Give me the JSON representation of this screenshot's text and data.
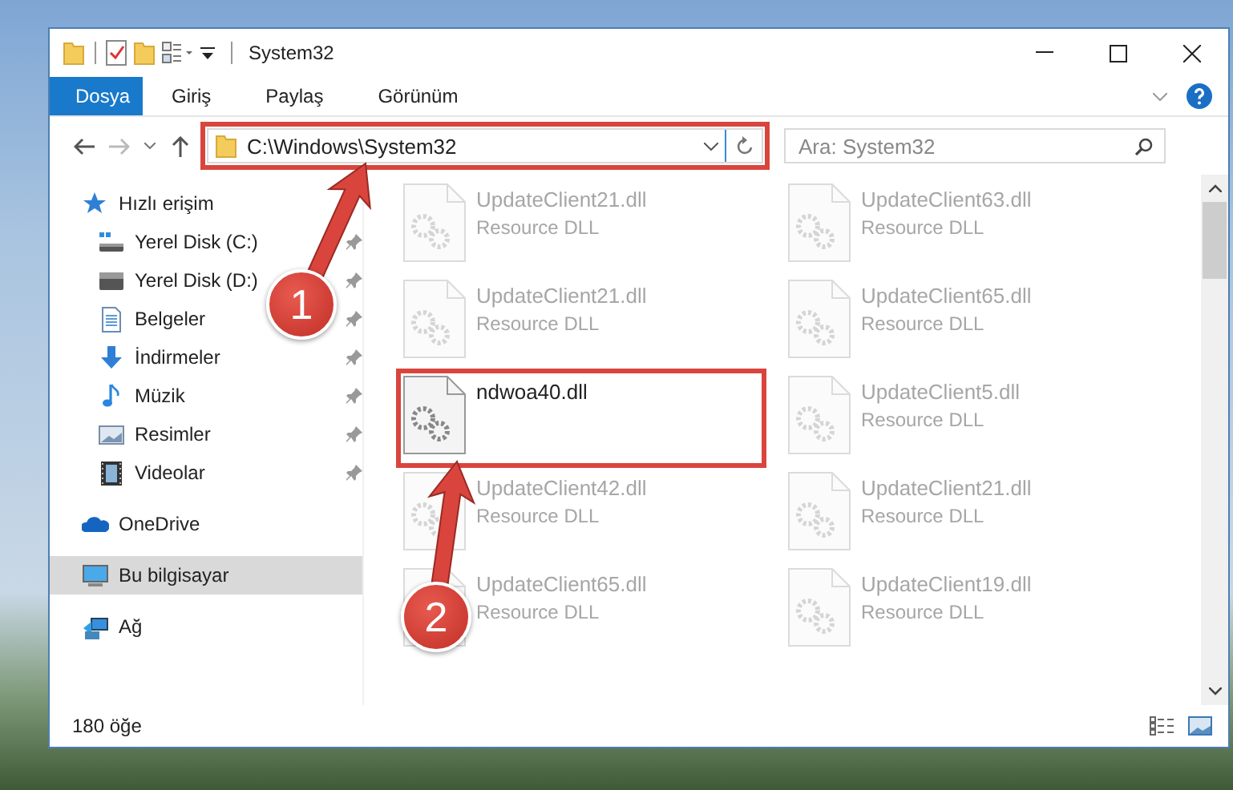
{
  "window": {
    "title": "System32"
  },
  "ribbon_tabs": [
    {
      "label": "Dosya",
      "selected": true
    },
    {
      "label": "Giriş",
      "selected": false
    },
    {
      "label": "Paylaş",
      "selected": false
    },
    {
      "label": "Görünüm",
      "selected": false
    }
  ],
  "address_bar": {
    "path": "C:\\Windows\\System32",
    "highlighted": true
  },
  "search": {
    "placeholder": "Ara: System32"
  },
  "navigation": [
    {
      "label": "Hızlı erişim",
      "kind": "star",
      "selected": false,
      "children": [
        {
          "label": "Yerel Disk (C:)",
          "kind": "system-drive",
          "pinned": true,
          "selected": false
        },
        {
          "label": "Yerel Disk (D:)",
          "kind": "drive",
          "pinned": true,
          "selected": false
        },
        {
          "label": "Belgeler",
          "kind": "documents",
          "pinned": true,
          "selected": false
        },
        {
          "label": "İndirmeler",
          "kind": "downloads",
          "pinned": true,
          "selected": false
        },
        {
          "label": "Müzik",
          "kind": "music",
          "pinned": true,
          "selected": false
        },
        {
          "label": "Resimler",
          "kind": "pictures",
          "pinned": true,
          "selected": false
        },
        {
          "label": "Videolar",
          "kind": "videos",
          "pinned": true,
          "selected": false
        }
      ]
    },
    {
      "label": "OneDrive",
      "kind": "cloud",
      "selected": false
    },
    {
      "label": "Bu bilgisayar",
      "kind": "computer",
      "selected": true
    },
    {
      "label": "Ağ",
      "kind": "network",
      "selected": false
    }
  ],
  "files": [
    {
      "name": "UpdateClient21.dll",
      "description": "Resource DLL",
      "dimmed": true,
      "outlined": false
    },
    {
      "name": "UpdateClient21.dll",
      "description": "Resource DLL",
      "dimmed": true,
      "outlined": false
    },
    {
      "name": "ndwoa40.dll",
      "dimmed": false,
      "outlined": true
    },
    {
      "name": "UpdateClient42.dll",
      "description": "Resource DLL",
      "dimmed": true,
      "outlined": false
    },
    {
      "name": "UpdateClient65.dll",
      "description": "Resource DLL",
      "dimmed": true,
      "outlined": false
    },
    {
      "name": "UpdateClient63.dll",
      "description": "Resource DLL",
      "dimmed": true,
      "outlined": false
    },
    {
      "name": "UpdateClient65.dll",
      "description": "Resource DLL",
      "dimmed": true,
      "outlined": false
    },
    {
      "name": "UpdateClient5.dll",
      "description": "Resource DLL",
      "dimmed": true,
      "outlined": false
    },
    {
      "name": "UpdateClient21.dll",
      "description": "Resource DLL",
      "dimmed": true,
      "outlined": false
    },
    {
      "name": "UpdateClient19.dll",
      "description": "Resource DLL",
      "dimmed": true,
      "outlined": false
    }
  ],
  "annotations": [
    {
      "number": "1"
    },
    {
      "number": "2"
    }
  ],
  "status_bar": {
    "item_count": "180 öğe"
  }
}
